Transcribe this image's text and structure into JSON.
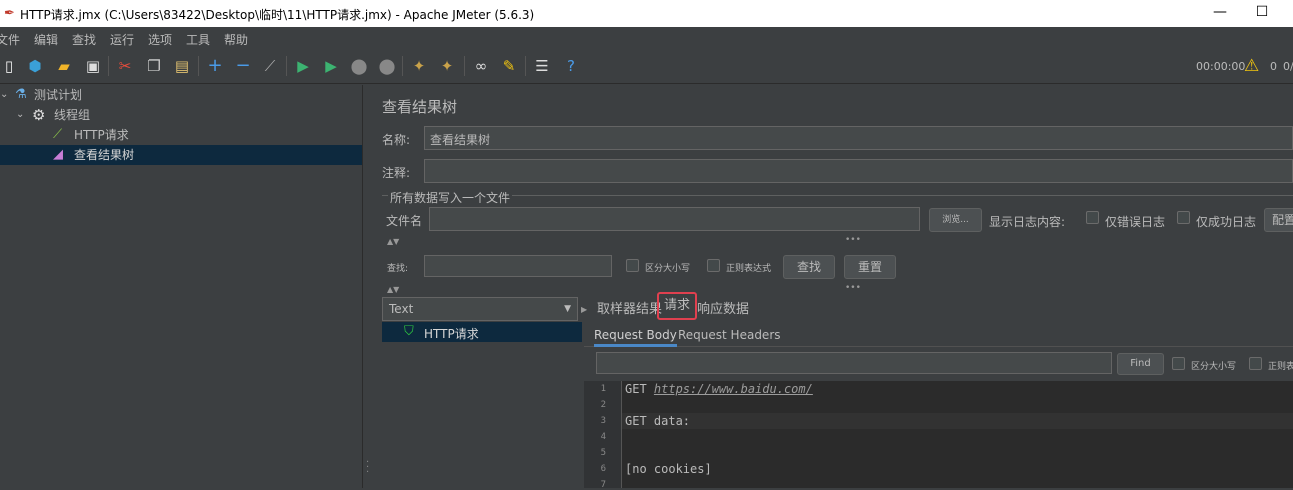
{
  "window": {
    "title": "HTTP请求.jmx (C:\\Users\\83422\\Desktop\\临时\\11\\HTTP请求.jmx) - Apache JMeter (5.6.3)",
    "minimize": "—",
    "maximize": "☐"
  },
  "menu": [
    "文件",
    "编辑",
    "查找",
    "运行",
    "选项",
    "工具",
    "帮助"
  ],
  "toolbar": {
    "timer": "00:00:00",
    "warn_count": "0",
    "thread_ratio": "0/"
  },
  "tree": {
    "plan": "测试计划",
    "thread_group": "线程组",
    "http_request": "HTTP请求",
    "result_tree": "查看结果树"
  },
  "panel": {
    "title": "查看结果树",
    "name_label": "名称:",
    "name_value": "查看结果树",
    "comment_label": "注释:",
    "comment_value": "",
    "file_group_title": "所有数据写入一个文件",
    "file_label": "文件名",
    "browse_button": "浏览...",
    "log_label": "显示日志内容:",
    "errors_only": "仅错误日志",
    "success_only": "仅成功日志",
    "configure_button": "配置",
    "search_label": "查找:",
    "case_sensitive": "区分大小写",
    "regex": "正则表达式",
    "search_button": "查找",
    "reset_button": "重置"
  },
  "results": {
    "renderer": "Text",
    "items": [
      "HTTP请求"
    ],
    "tabs": [
      "取样器结果",
      "请求",
      "响应数据"
    ],
    "active_tab": "请求",
    "subtabs": [
      "Request Body",
      "Request Headers"
    ],
    "active_subtab": "Request Body",
    "find_button": "Find",
    "find_case": "区分大小写",
    "find_regex": "正则表达式"
  },
  "editor": {
    "line_numbers": [
      "1",
      "2",
      "3",
      "4",
      "5",
      "6",
      "7"
    ],
    "get_prefix": "GET ",
    "url": "https://www.baidu.com/",
    "get_data": "GET data:",
    "cookies": "[no cookies]"
  }
}
